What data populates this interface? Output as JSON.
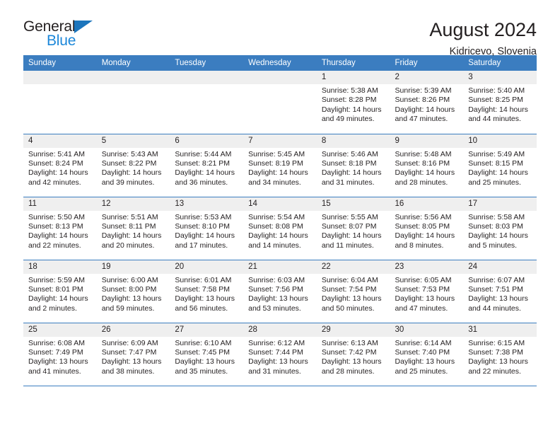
{
  "brand": {
    "name_part1": "General",
    "name_part2": "Blue",
    "triangle_color": "#1c75bc",
    "blue_color": "#1c87d9"
  },
  "header": {
    "title": "August 2024",
    "subtitle": "Kidricevo, Slovenia",
    "header_bg": "#3b7dc0",
    "daynum_bg": "#efefef"
  },
  "weekdays": [
    "Sunday",
    "Monday",
    "Tuesday",
    "Wednesday",
    "Thursday",
    "Friday",
    "Saturday"
  ],
  "labels": {
    "sunrise": "Sunrise:",
    "sunset": "Sunset:",
    "daylight": "Daylight:"
  },
  "weeks": [
    [
      {
        "day": ""
      },
      {
        "day": ""
      },
      {
        "day": ""
      },
      {
        "day": ""
      },
      {
        "day": "1",
        "sunrise": "Sunrise: 5:38 AM",
        "sunset": "Sunset: 8:28 PM",
        "daylight1": "Daylight: 14 hours",
        "daylight2": "and 49 minutes."
      },
      {
        "day": "2",
        "sunrise": "Sunrise: 5:39 AM",
        "sunset": "Sunset: 8:26 PM",
        "daylight1": "Daylight: 14 hours",
        "daylight2": "and 47 minutes."
      },
      {
        "day": "3",
        "sunrise": "Sunrise: 5:40 AM",
        "sunset": "Sunset: 8:25 PM",
        "daylight1": "Daylight: 14 hours",
        "daylight2": "and 44 minutes."
      }
    ],
    [
      {
        "day": "4",
        "sunrise": "Sunrise: 5:41 AM",
        "sunset": "Sunset: 8:24 PM",
        "daylight1": "Daylight: 14 hours",
        "daylight2": "and 42 minutes."
      },
      {
        "day": "5",
        "sunrise": "Sunrise: 5:43 AM",
        "sunset": "Sunset: 8:22 PM",
        "daylight1": "Daylight: 14 hours",
        "daylight2": "and 39 minutes."
      },
      {
        "day": "6",
        "sunrise": "Sunrise: 5:44 AM",
        "sunset": "Sunset: 8:21 PM",
        "daylight1": "Daylight: 14 hours",
        "daylight2": "and 36 minutes."
      },
      {
        "day": "7",
        "sunrise": "Sunrise: 5:45 AM",
        "sunset": "Sunset: 8:19 PM",
        "daylight1": "Daylight: 14 hours",
        "daylight2": "and 34 minutes."
      },
      {
        "day": "8",
        "sunrise": "Sunrise: 5:46 AM",
        "sunset": "Sunset: 8:18 PM",
        "daylight1": "Daylight: 14 hours",
        "daylight2": "and 31 minutes."
      },
      {
        "day": "9",
        "sunrise": "Sunrise: 5:48 AM",
        "sunset": "Sunset: 8:16 PM",
        "daylight1": "Daylight: 14 hours",
        "daylight2": "and 28 minutes."
      },
      {
        "day": "10",
        "sunrise": "Sunrise: 5:49 AM",
        "sunset": "Sunset: 8:15 PM",
        "daylight1": "Daylight: 14 hours",
        "daylight2": "and 25 minutes."
      }
    ],
    [
      {
        "day": "11",
        "sunrise": "Sunrise: 5:50 AM",
        "sunset": "Sunset: 8:13 PM",
        "daylight1": "Daylight: 14 hours",
        "daylight2": "and 22 minutes."
      },
      {
        "day": "12",
        "sunrise": "Sunrise: 5:51 AM",
        "sunset": "Sunset: 8:11 PM",
        "daylight1": "Daylight: 14 hours",
        "daylight2": "and 20 minutes."
      },
      {
        "day": "13",
        "sunrise": "Sunrise: 5:53 AM",
        "sunset": "Sunset: 8:10 PM",
        "daylight1": "Daylight: 14 hours",
        "daylight2": "and 17 minutes."
      },
      {
        "day": "14",
        "sunrise": "Sunrise: 5:54 AM",
        "sunset": "Sunset: 8:08 PM",
        "daylight1": "Daylight: 14 hours",
        "daylight2": "and 14 minutes."
      },
      {
        "day": "15",
        "sunrise": "Sunrise: 5:55 AM",
        "sunset": "Sunset: 8:07 PM",
        "daylight1": "Daylight: 14 hours",
        "daylight2": "and 11 minutes."
      },
      {
        "day": "16",
        "sunrise": "Sunrise: 5:56 AM",
        "sunset": "Sunset: 8:05 PM",
        "daylight1": "Daylight: 14 hours",
        "daylight2": "and 8 minutes."
      },
      {
        "day": "17",
        "sunrise": "Sunrise: 5:58 AM",
        "sunset": "Sunset: 8:03 PM",
        "daylight1": "Daylight: 14 hours",
        "daylight2": "and 5 minutes."
      }
    ],
    [
      {
        "day": "18",
        "sunrise": "Sunrise: 5:59 AM",
        "sunset": "Sunset: 8:01 PM",
        "daylight1": "Daylight: 14 hours",
        "daylight2": "and 2 minutes."
      },
      {
        "day": "19",
        "sunrise": "Sunrise: 6:00 AM",
        "sunset": "Sunset: 8:00 PM",
        "daylight1": "Daylight: 13 hours",
        "daylight2": "and 59 minutes."
      },
      {
        "day": "20",
        "sunrise": "Sunrise: 6:01 AM",
        "sunset": "Sunset: 7:58 PM",
        "daylight1": "Daylight: 13 hours",
        "daylight2": "and 56 minutes."
      },
      {
        "day": "21",
        "sunrise": "Sunrise: 6:03 AM",
        "sunset": "Sunset: 7:56 PM",
        "daylight1": "Daylight: 13 hours",
        "daylight2": "and 53 minutes."
      },
      {
        "day": "22",
        "sunrise": "Sunrise: 6:04 AM",
        "sunset": "Sunset: 7:54 PM",
        "daylight1": "Daylight: 13 hours",
        "daylight2": "and 50 minutes."
      },
      {
        "day": "23",
        "sunrise": "Sunrise: 6:05 AM",
        "sunset": "Sunset: 7:53 PM",
        "daylight1": "Daylight: 13 hours",
        "daylight2": "and 47 minutes."
      },
      {
        "day": "24",
        "sunrise": "Sunrise: 6:07 AM",
        "sunset": "Sunset: 7:51 PM",
        "daylight1": "Daylight: 13 hours",
        "daylight2": "and 44 minutes."
      }
    ],
    [
      {
        "day": "25",
        "sunrise": "Sunrise: 6:08 AM",
        "sunset": "Sunset: 7:49 PM",
        "daylight1": "Daylight: 13 hours",
        "daylight2": "and 41 minutes."
      },
      {
        "day": "26",
        "sunrise": "Sunrise: 6:09 AM",
        "sunset": "Sunset: 7:47 PM",
        "daylight1": "Daylight: 13 hours",
        "daylight2": "and 38 minutes."
      },
      {
        "day": "27",
        "sunrise": "Sunrise: 6:10 AM",
        "sunset": "Sunset: 7:45 PM",
        "daylight1": "Daylight: 13 hours",
        "daylight2": "and 35 minutes."
      },
      {
        "day": "28",
        "sunrise": "Sunrise: 6:12 AM",
        "sunset": "Sunset: 7:44 PM",
        "daylight1": "Daylight: 13 hours",
        "daylight2": "and 31 minutes."
      },
      {
        "day": "29",
        "sunrise": "Sunrise: 6:13 AM",
        "sunset": "Sunset: 7:42 PM",
        "daylight1": "Daylight: 13 hours",
        "daylight2": "and 28 minutes."
      },
      {
        "day": "30",
        "sunrise": "Sunrise: 6:14 AM",
        "sunset": "Sunset: 7:40 PM",
        "daylight1": "Daylight: 13 hours",
        "daylight2": "and 25 minutes."
      },
      {
        "day": "31",
        "sunrise": "Sunrise: 6:15 AM",
        "sunset": "Sunset: 7:38 PM",
        "daylight1": "Daylight: 13 hours",
        "daylight2": "and 22 minutes."
      }
    ]
  ]
}
